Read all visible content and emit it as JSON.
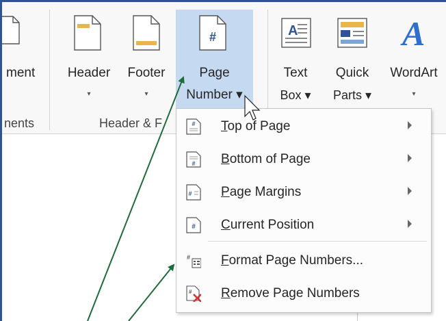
{
  "ribbon": {
    "buttons": [
      {
        "id": "partial-left",
        "line1": "ment",
        "line2": ""
      },
      {
        "id": "header",
        "line1": "Header",
        "line2": "▾"
      },
      {
        "id": "footer",
        "line1": "Footer",
        "line2": "▾"
      },
      {
        "id": "page-number",
        "line1": "Page",
        "line2": "Number ▾"
      },
      {
        "id": "text-box",
        "line1": "Text",
        "line2": "Box ▾"
      },
      {
        "id": "quick-parts",
        "line1": "Quick",
        "line2": "Parts ▾"
      },
      {
        "id": "wordart",
        "line1": "WordArt",
        "line2": "▾"
      }
    ],
    "groups": [
      {
        "id": "left-partial",
        "label": "nents"
      },
      {
        "id": "header-footer",
        "label": "Header & F"
      }
    ]
  },
  "menu": {
    "items": [
      {
        "underline": "T",
        "rest": "op of Page",
        "submenu": true,
        "icon": "top-of-page-icon"
      },
      {
        "underline": "B",
        "rest": "ottom of Page",
        "submenu": true,
        "icon": "bottom-of-page-icon"
      },
      {
        "underline": "P",
        "rest": "age Margins",
        "submenu": true,
        "icon": "page-margins-icon"
      },
      {
        "underline": "C",
        "rest": "urrent Position",
        "submenu": true,
        "icon": "current-position-icon"
      },
      {
        "underline": "F",
        "rest": "ormat Page Numbers...",
        "submenu": false,
        "icon": "format-page-numbers-icon"
      },
      {
        "underline": "R",
        "rest": "emove Page Numbers",
        "submenu": false,
        "icon": "remove-page-numbers-icon"
      }
    ]
  },
  "colors": {
    "active_button": "#c5d9f1",
    "annotation_arrow": "#1e6b3c",
    "accent_blue": "#2f5496",
    "remove_x": "#d13438",
    "footer_bar": "#e8b64a"
  }
}
